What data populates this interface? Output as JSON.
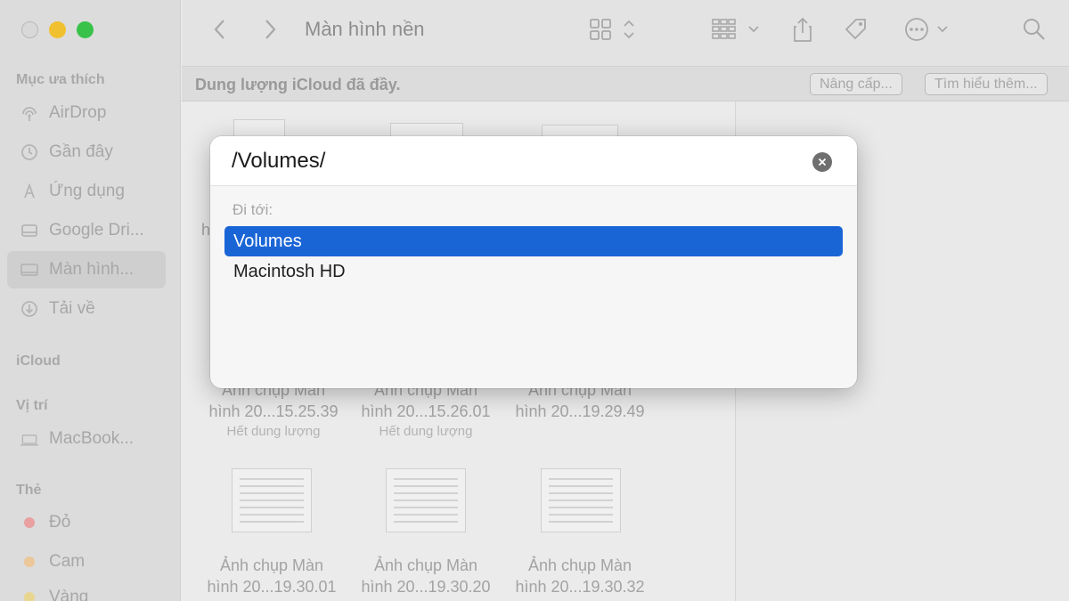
{
  "sidebar": {
    "favorites_header": "Mục ưa thích",
    "favorites": [
      {
        "label": "AirDrop",
        "icon": "airdrop-icon"
      },
      {
        "label": "Gần đây",
        "icon": "clock-icon"
      },
      {
        "label": "Ứng dụng",
        "icon": "applications-icon"
      },
      {
        "label": "Google Dri...",
        "icon": "google-drive-icon"
      },
      {
        "label": "Màn hình...",
        "icon": "desktop-icon",
        "selected": true
      },
      {
        "label": "Tải về",
        "icon": "download-icon"
      }
    ],
    "icloud_header": "iCloud",
    "locations_header": "Vị trí",
    "locations": [
      {
        "label": "MacBook...",
        "icon": "laptop-icon"
      }
    ],
    "tags_header": "Thẻ",
    "tags": [
      {
        "label": "Đỏ",
        "color": "#e8a0a0"
      },
      {
        "label": "Cam",
        "color": "#ebc79a"
      },
      {
        "label": "Vàng",
        "color": "#e8d590"
      }
    ]
  },
  "toolbar": {
    "title": "Màn hình nền"
  },
  "banner": {
    "text": "Dung lượng iCloud đã đầy.",
    "upgrade_label": "Nâng cấp...",
    "learn_more_label": "Tìm hiểu thêm..."
  },
  "files": {
    "row1": [
      {
        "line1": "Ảnh chụp Màn",
        "line2": "hình 20...15.25.39",
        "status": "Hết dung lượng"
      },
      {
        "line1": "Ảnh chụp Màn",
        "line2": "hình 20...15.26.01",
        "status": "Hết dung lượng"
      },
      {
        "line1": "Ảnh chụp Màn",
        "line2": "hình 20...19.29.49",
        "status": ""
      }
    ],
    "row2": [
      {
        "line1": "Ảnh chụp Màn",
        "line2": "hình 20...19.30.01"
      },
      {
        "line1": "Ảnh chụp Màn",
        "line2": "hình 20...19.30.20"
      },
      {
        "line1": "Ảnh chụp Màn",
        "line2": "hình 20...19.30.32"
      }
    ],
    "partial_left": "h"
  },
  "dialog": {
    "path_value": "/Volumes/",
    "goto_label": "Đi tới:",
    "suggestions": [
      {
        "label": "Volumes",
        "selected": true
      },
      {
        "label": "Macintosh HD",
        "selected": false
      }
    ],
    "accent": "#1a65d6"
  }
}
